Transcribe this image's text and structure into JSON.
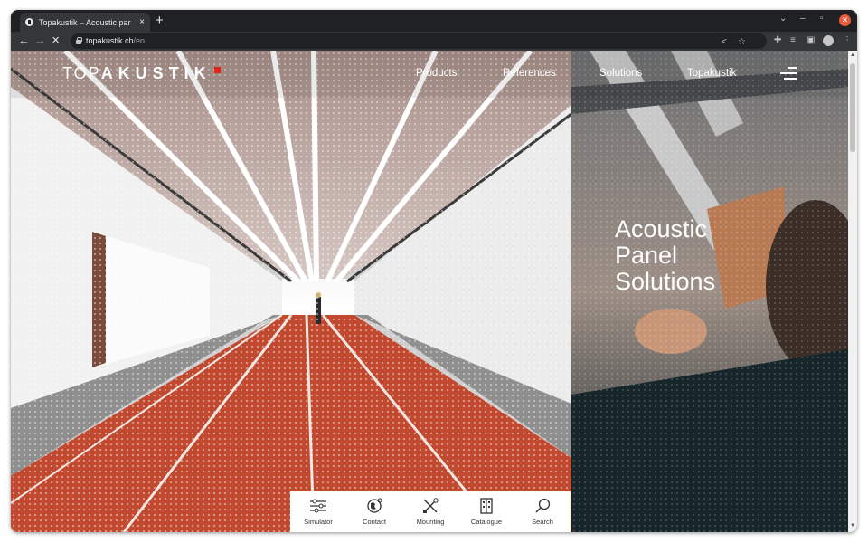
{
  "browser": {
    "tab_title": "Topakustik – Acoustic par",
    "tab_close": "×",
    "new_tab": "+",
    "url_domain": "topakustik.ch",
    "url_path": "/en",
    "back": "←",
    "forward": "→",
    "reload": "✕",
    "window_controls": {
      "chevron": "⌄",
      "minimize": "–",
      "maximize": "▫",
      "close": "✕"
    }
  },
  "site": {
    "logo_left": "TOP",
    "logo_right": "AKUSTIK",
    "nav": [
      "Products",
      "References",
      "Solutions",
      "Topakustik"
    ],
    "headline": [
      "Acoustic",
      "Panel",
      "Solutions"
    ]
  },
  "quickbar": [
    {
      "label": "Simulator",
      "icon": "sliders-icon"
    },
    {
      "label": "Contact",
      "icon": "globe-icon"
    },
    {
      "label": "Mounting",
      "icon": "tools-icon"
    },
    {
      "label": "Catalogue",
      "icon": "catalogue-icon"
    },
    {
      "label": "Search",
      "icon": "search-icon"
    }
  ],
  "colors": {
    "track_red": "#c1492f",
    "ceiling": "#b49c94",
    "accent_red": "#e2231a"
  }
}
